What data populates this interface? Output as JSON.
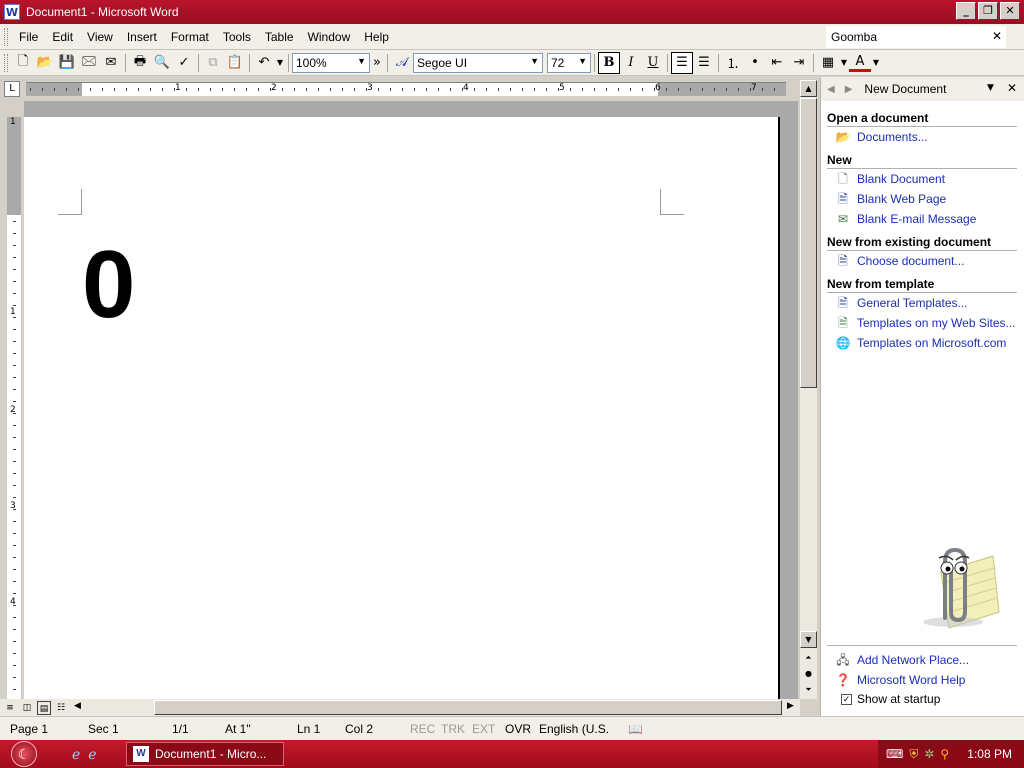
{
  "window": {
    "title": "Document1 - Microsoft Word",
    "app_icon": "W"
  },
  "menu": {
    "items": [
      {
        "label": "File",
        "key": "F"
      },
      {
        "label": "Edit",
        "key": "E"
      },
      {
        "label": "View",
        "key": "V"
      },
      {
        "label": "Insert",
        "key": "I"
      },
      {
        "label": "Format",
        "key": "o"
      },
      {
        "label": "Tools",
        "key": "T"
      },
      {
        "label": "Table",
        "key": "a"
      },
      {
        "label": "Window",
        "key": "W"
      },
      {
        "label": "Help",
        "key": "H"
      }
    ],
    "help_box_value": "Goomba"
  },
  "toolbar": {
    "zoom": "100%",
    "font_name": "Segoe UI",
    "font_size": "72",
    "bold_label": "B",
    "italic_label": "I",
    "underline_label": "U"
  },
  "ruler": {
    "numbers": [
      "1",
      "2",
      "3",
      "4",
      "5",
      "6",
      "7"
    ]
  },
  "vruler": {
    "numbers": [
      "1",
      "1",
      "2",
      "3",
      "4"
    ]
  },
  "document": {
    "text": "0"
  },
  "task_pane": {
    "title": "New Document",
    "sections": {
      "open": {
        "heading": "Open a document",
        "links": [
          "Documents..."
        ]
      },
      "new": {
        "heading": "New",
        "links": [
          "Blank Document",
          "Blank Web Page",
          "Blank E-mail Message"
        ]
      },
      "existing": {
        "heading": "New from existing document",
        "links": [
          "Choose document..."
        ]
      },
      "template": {
        "heading": "New from template",
        "links": [
          "General Templates...",
          "Templates on my Web Sites...",
          "Templates on Microsoft.com"
        ]
      }
    },
    "bottom_links": [
      "Add Network Place...",
      "Microsoft Word Help"
    ],
    "show_at_startup": "Show at startup"
  },
  "status": {
    "page": "Page  1",
    "sec": "Sec  1",
    "pages": "1/1",
    "at": "At  1\"",
    "ln": "Ln  1",
    "col": "Col  2",
    "rec": "REC",
    "trk": "TRK",
    "ext": "EXT",
    "ovr": "OVR",
    "language": "English (U.S."
  },
  "taskbar": {
    "task_label": "Document1 - Micro...",
    "clock": "1:08 PM"
  },
  "colors": {
    "title_red": "#b8142c",
    "link_blue": "#1a2fb5",
    "taskbar_red": "#c41a2c"
  }
}
